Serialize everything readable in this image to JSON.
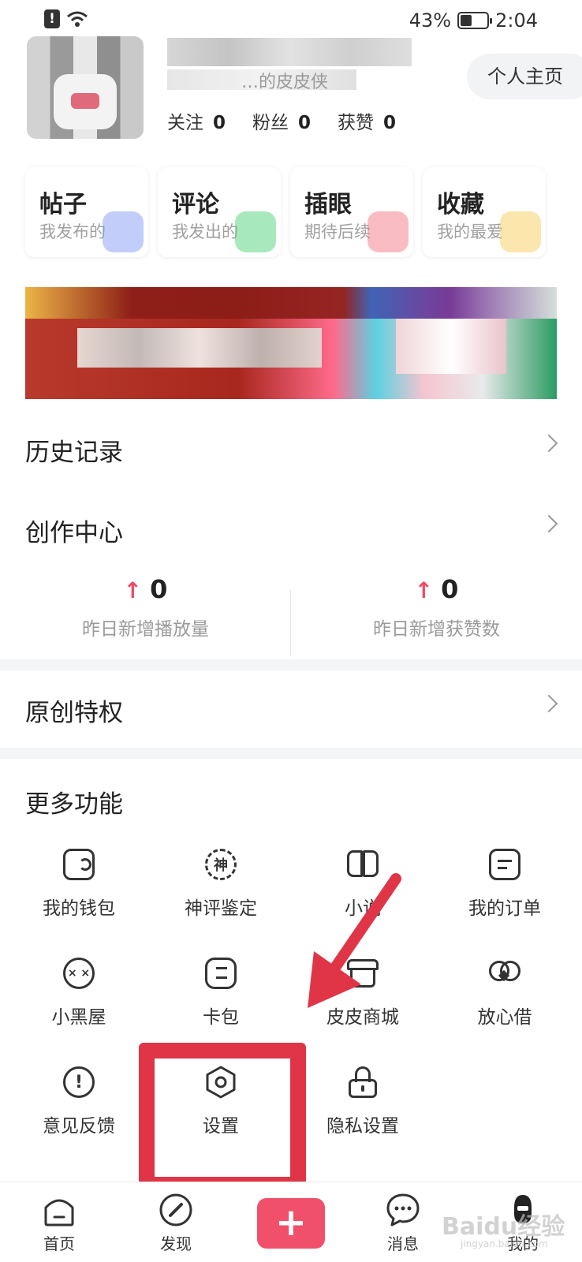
{
  "status_bar": {
    "battery": "43%",
    "battery_level": 0.43,
    "time": "2:04"
  },
  "profile": {
    "subtitle": "…的皮皮侠",
    "home_button": "个人主页",
    "stats": [
      {
        "label": "关注",
        "value": "0"
      },
      {
        "label": "粉丝",
        "value": "0"
      },
      {
        "label": "获赞",
        "value": "0"
      }
    ]
  },
  "quick_cards": [
    {
      "title": "帖子",
      "subtitle": "我发布的",
      "color": "#7a90f5"
    },
    {
      "title": "评论",
      "subtitle": "我发出的",
      "color": "#3ccf6a"
    },
    {
      "title": "插眼",
      "subtitle": "期待后续",
      "color": "#f56a7a"
    },
    {
      "title": "收藏",
      "subtitle": "我的最爱",
      "color": "#f7c74a"
    }
  ],
  "rows": {
    "history": "历史记录",
    "creator": "创作中心",
    "original": "原创特权"
  },
  "creator_stats": [
    {
      "value": "0",
      "label": "昨日新增播放量"
    },
    {
      "value": "0",
      "label": "昨日新增获赞数"
    }
  ],
  "more": {
    "title": "更多功能",
    "items": [
      {
        "label": "我的钱包",
        "icon": "wallet-icon"
      },
      {
        "label": "神评鉴定",
        "icon": "shen-badge-icon",
        "glyph": "神"
      },
      {
        "label": "小说",
        "icon": "book-icon"
      },
      {
        "label": "我的订单",
        "icon": "order-icon"
      },
      {
        "label": "小黑屋",
        "icon": "dizzy-face-icon"
      },
      {
        "label": "卡包",
        "icon": "card-holder-icon"
      },
      {
        "label": "皮皮商城",
        "icon": "shop-icon"
      },
      {
        "label": "放心借",
        "icon": "loan-icon"
      },
      {
        "label": "意见反馈",
        "icon": "feedback-icon",
        "glyph": "!"
      },
      {
        "label": "设置",
        "icon": "settings-hexagon-icon"
      },
      {
        "label": "隐私设置",
        "icon": "lock-icon"
      }
    ]
  },
  "tabbar": [
    {
      "label": "首页",
      "icon": "home-icon"
    },
    {
      "label": "发现",
      "icon": "compass-icon"
    },
    {
      "label": "消息",
      "icon": "message-icon"
    },
    {
      "label": "我的",
      "icon": "profile-icon"
    }
  ],
  "plus_label": "+",
  "watermark": {
    "brand": "Baidu经验",
    "url": "jingyan.baidu.com"
  },
  "colors": {
    "accent": "#f0506a",
    "highlight": "#e03547",
    "up_arrow": "#f04b64"
  }
}
